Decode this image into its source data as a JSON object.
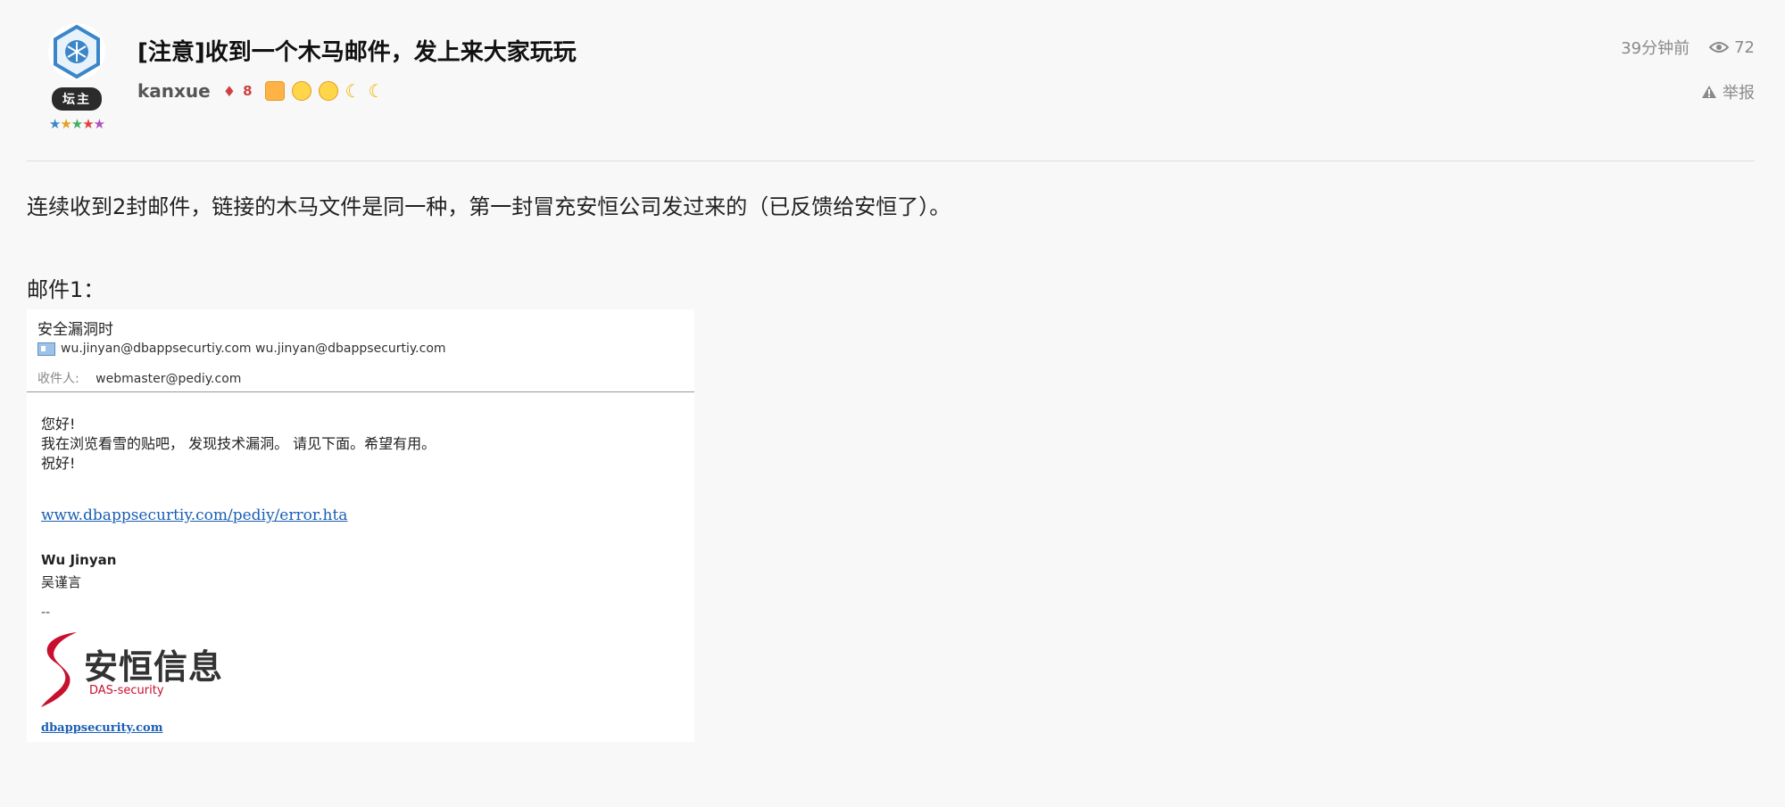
{
  "post": {
    "title": "[注意]收到一个木马邮件，发上来大家玩玩",
    "time_ago": "39分钟前",
    "views": "72",
    "report_label": "举报"
  },
  "author": {
    "username": "kanxue",
    "role_badge": "坛主",
    "level": "8",
    "stars": "★★★★★"
  },
  "content": {
    "paragraph": "连续收到2封邮件，链接的木马文件是同一种，第一封冒充安恒公司发过来的（已反馈给安恒了）。",
    "mail_label": "邮件1："
  },
  "email": {
    "subject": "安全漏洞时",
    "from": "wu.jinyan@dbappsecurtiy.com wu.jinyan@dbappsecurtiy.com",
    "to_label": "收件人:",
    "to": "webmaster@pediy.com",
    "greeting": "您好!",
    "line1": "我在浏览看雪的贴吧，  发现技术漏洞。 请见下面。希望有用。",
    "closing": "祝好!",
    "link": "www.dbappsecurtiy.com/pediy/error.hta",
    "sig_name": "Wu Jinyan",
    "sig_cn": "吴谨言",
    "sig_dash": "--",
    "logo_text": "安恒信息",
    "logo_sub": "DAS-security",
    "logo_link": "dbappsecurity.com"
  },
  "colors": {
    "background": "#f8f8f8",
    "link": "#1a5fb4",
    "logo_red": "#c8102e"
  }
}
